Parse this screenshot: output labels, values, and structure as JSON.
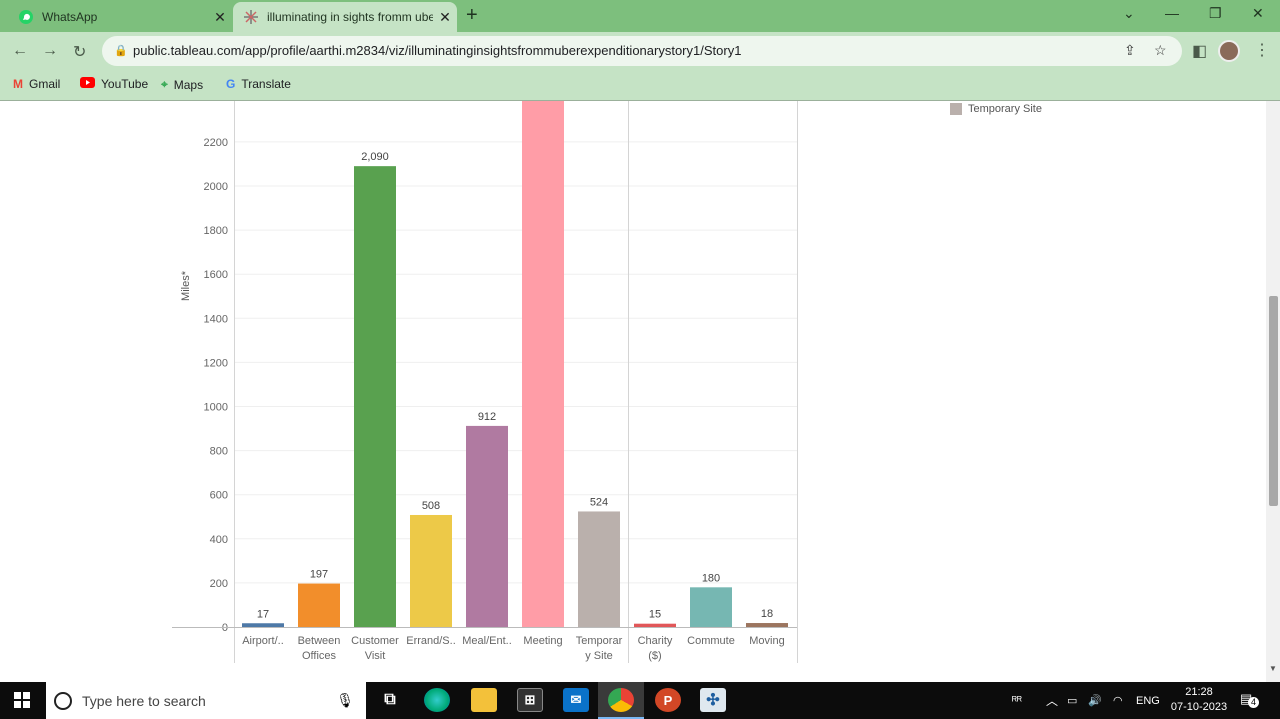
{
  "browser": {
    "tabs": [
      {
        "title": "WhatsApp",
        "icon": "whatsapp-icon"
      },
      {
        "title": "illuminating in sights fromm ube",
        "icon": "tableau-icon"
      }
    ],
    "url": "public.tableau.com/app/profile/aarthi.m2834/viz/illuminatinginsightsfrommuberexpenditionarystory1/Story1",
    "bookmarks": [
      {
        "label": "Gmail",
        "icon": "gmail-icon",
        "color": "#EA4335"
      },
      {
        "label": "YouTube",
        "icon": "youtube-icon",
        "color": "#FF0000"
      },
      {
        "label": "Maps",
        "icon": "maps-icon",
        "color": "#34A853"
      },
      {
        "label": "Translate",
        "icon": "translate-icon",
        "color": "#4285F4"
      }
    ]
  },
  "legend": {
    "label": "Temporary Site",
    "color": "#bab0ac"
  },
  "chart_data": {
    "type": "bar",
    "ylabel": "Miles*",
    "ylim": [
      0,
      2200
    ],
    "yticks": [
      0,
      200,
      400,
      600,
      800,
      1000,
      1200,
      1400,
      1600,
      1800,
      2000,
      2200
    ],
    "groups": [
      {
        "bars": [
          {
            "label": [
              "Airport/.."
            ],
            "value": 17,
            "value_label": "17",
            "color": "#4e79a7"
          },
          {
            "label": [
              "Between",
              "Offices"
            ],
            "value": 197,
            "value_label": "197",
            "color": "#f28e2b"
          },
          {
            "label": [
              "Customer",
              "Visit"
            ],
            "value": 2090,
            "value_label": "2,090",
            "color": "#59a14f"
          },
          {
            "label": [
              "Errand/S.."
            ],
            "value": 508,
            "value_label": "508",
            "color": "#edc948"
          },
          {
            "label": [
              "Meal/Ent.."
            ],
            "value": 912,
            "value_label": "912",
            "color": "#b07aa1"
          },
          {
            "label": [
              "Meeting"
            ],
            "value": 2400,
            "value_label": "",
            "color": "#ff9da7"
          },
          {
            "label": [
              "Temporar",
              "y Site"
            ],
            "value": 524,
            "value_label": "524",
            "color": "#bab0ac"
          }
        ]
      },
      {
        "bars": [
          {
            "label": [
              "Charity",
              "($)"
            ],
            "value": 15,
            "value_label": "15",
            "color": "#e15759"
          },
          {
            "label": [
              "Commute"
            ],
            "value": 180,
            "value_label": "180",
            "color": "#76b7b2"
          },
          {
            "label": [
              "Moving"
            ],
            "value": 18,
            "value_label": "18",
            "color": "#9c755f"
          }
        ]
      }
    ]
  },
  "taskbar": {
    "search_placeholder": "Type here to search",
    "language": "ENG",
    "time": "21:28",
    "date": "07-10-2023",
    "notifications": "4"
  }
}
